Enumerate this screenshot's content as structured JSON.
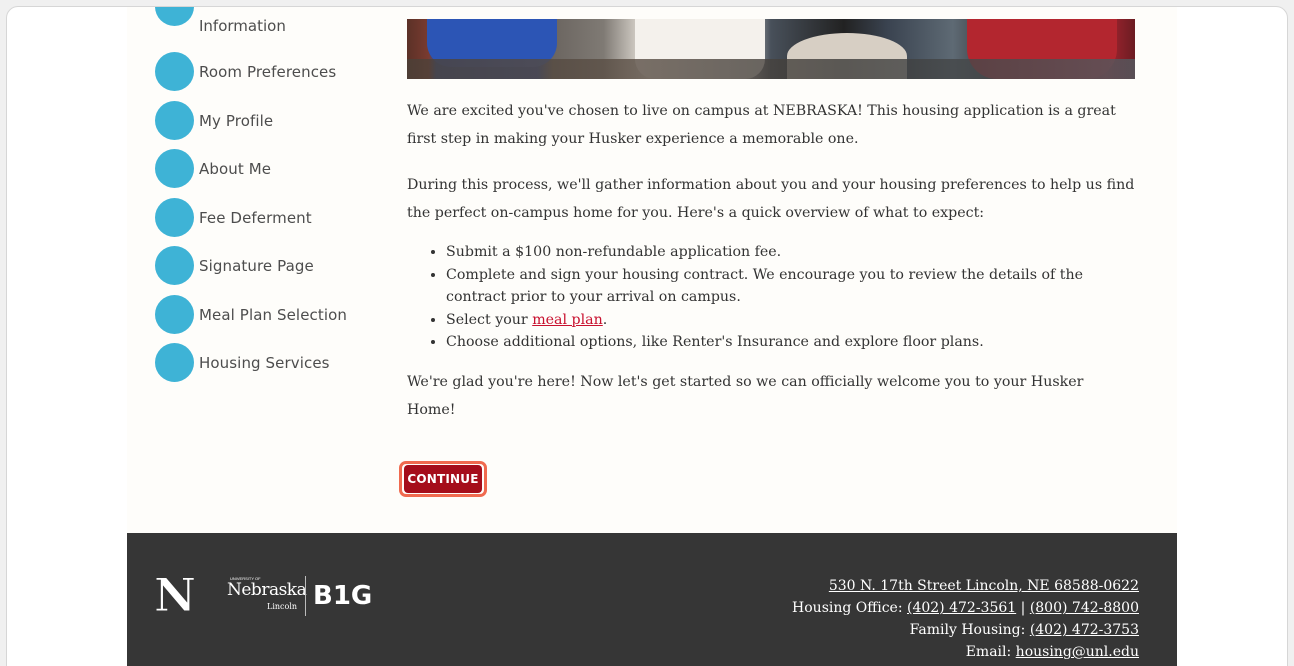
{
  "sidebar": {
    "steps": [
      {
        "label": "Information"
      },
      {
        "label": "Room Preferences"
      },
      {
        "label": "My Profile"
      },
      {
        "label": "About Me"
      },
      {
        "label": "Fee Deferment"
      },
      {
        "label": "Signature Page"
      },
      {
        "label": "Meal Plan Selection"
      },
      {
        "label": "Housing Services"
      }
    ]
  },
  "main": {
    "intro_1": "We are excited you've chosen to live on campus at NEBRASKA! This housing application is a great first step in making your Husker experience a memorable one.",
    "intro_2": "During this process, we'll gather information about you and your housing preferences to help us find the perfect on-campus home for you. Here's a quick overview of what to expect:",
    "bullets": {
      "b1": "Submit a $100 non-refundable application fee.",
      "b2": "Complete and sign your housing contract. We encourage you to review the details of the contract prior to your arrival on campus.",
      "b3_prefix": "Select your ",
      "b3_link": "meal plan",
      "b3_suffix": ".",
      "b4": "Choose additional options, like Renter's Insurance and explore floor plans."
    },
    "closing": "We're glad you're here! Now let's get started so we can officially welcome you to your Husker Home!",
    "continue_label": "CONTINUE"
  },
  "footer": {
    "n_logo": "N",
    "nebraska_word": "Nebraska",
    "university_of": "UNIVERSITY OF",
    "lincoln_word": "Lincoln",
    "big_logo": "B1G",
    "address": "530 N. 17th Street Lincoln, NE 68588-0622",
    "housing_office_label": "Housing Office: ",
    "housing_office_phone_1": "(402) 472-3561",
    "separator": " | ",
    "housing_office_phone_2": "(800) 742-8800",
    "family_housing_label": "Family Housing: ",
    "family_housing_phone": "(402) 472-3753",
    "email_label": "Email: ",
    "email": "housing@unl.edu"
  },
  "colors": {
    "step_dot": "#3eb3d6",
    "continue_bg": "#a50d1a",
    "continue_focus": "#f06a4f",
    "link": "#c8102e",
    "footer_bg": "#363636"
  }
}
